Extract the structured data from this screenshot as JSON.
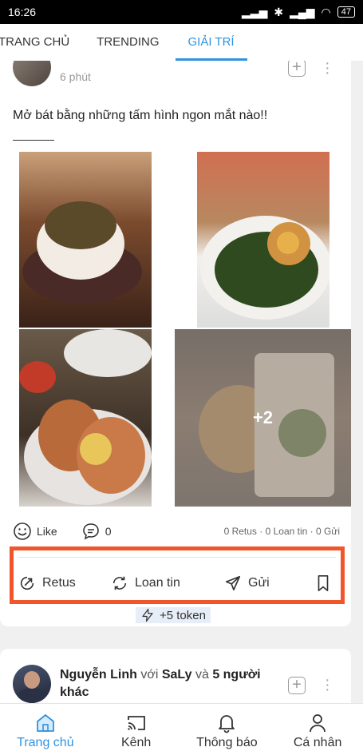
{
  "status_bar": {
    "time": "16:26",
    "battery": "47"
  },
  "tabs": [
    {
      "label": "TRANG CHỦ",
      "active": false
    },
    {
      "label": "TRENDING",
      "active": false
    },
    {
      "label": "GIẢI TRÍ",
      "active": true
    }
  ],
  "post1": {
    "time": "6 phút",
    "text": "Mở bát bằng những tấm hình ngon mắt nào!!",
    "more_photos": "+2",
    "like_label": "Like",
    "comment_count": "0",
    "counts": "0 Retus · 0 Loan tin · 0 Gửi",
    "actions": {
      "retus": "Retus",
      "loan_tin": "Loan tin",
      "gui": "Gửi"
    },
    "token": "+5 token"
  },
  "post2": {
    "author": "Nguyễn Linh",
    "with_word": "với",
    "with_name": "SaLy",
    "and_word": "và",
    "others": "5 người khác"
  },
  "bottom_nav": [
    {
      "label": "Trang chủ",
      "icon": "home-icon",
      "active": true
    },
    {
      "label": "Kênh",
      "icon": "cast-icon",
      "active": false
    },
    {
      "label": "Thông báo",
      "icon": "bell-icon",
      "active": false
    },
    {
      "label": "Cá nhân",
      "icon": "person-icon",
      "active": false
    }
  ],
  "colors": {
    "accent": "#2f93e0",
    "highlight_box": "#f0552b"
  }
}
